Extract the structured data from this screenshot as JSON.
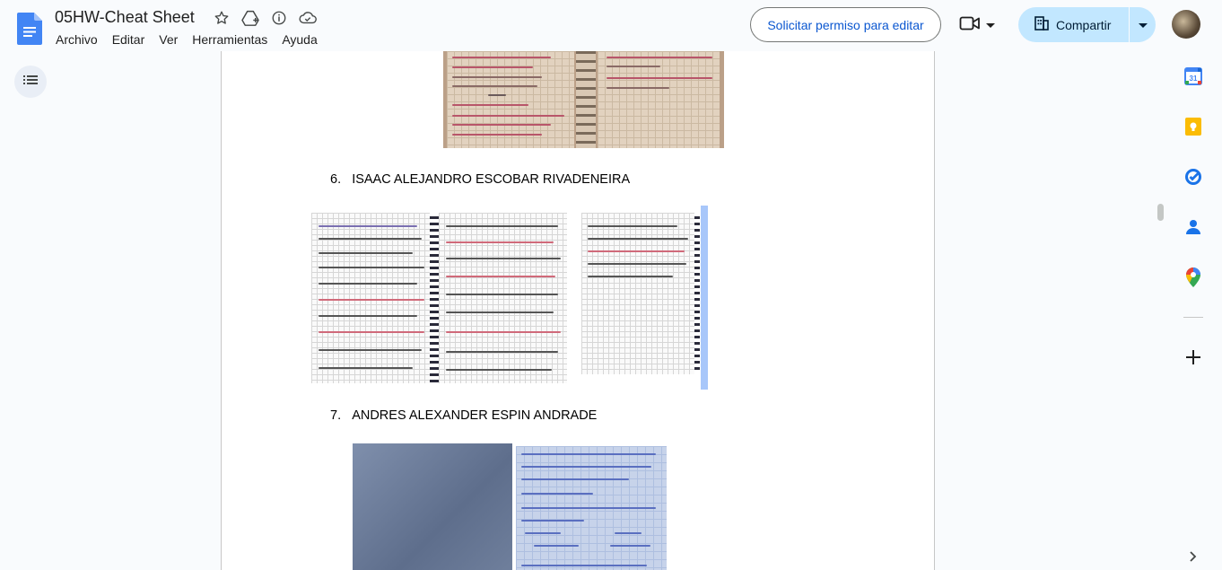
{
  "app": {
    "title": "05HW-Cheat Sheet",
    "menus": [
      "Archivo",
      "Editar",
      "Ver",
      "Herramientas",
      "Ayuda"
    ]
  },
  "toolbar": {
    "request_permission_label": "Solicitar permiso para editar",
    "share_label": "Compartir"
  },
  "document": {
    "sections": [
      {
        "number": "6.",
        "name": "ISAAC ALEJANDRO ESCOBAR RIVADENEIRA"
      },
      {
        "number": "7.",
        "name": "ANDRES ALEXANDER ESPIN ANDRADE"
      }
    ]
  },
  "side_panel": {
    "icons": [
      "calendar-icon",
      "keep-icon",
      "tasks-icon",
      "contacts-icon",
      "maps-icon",
      "add-icon"
    ],
    "calendar_day": "31"
  },
  "colors": {
    "accent": "#0b57d0",
    "share_bg": "#c2e7ff",
    "docs_blue": "#4285f4"
  }
}
